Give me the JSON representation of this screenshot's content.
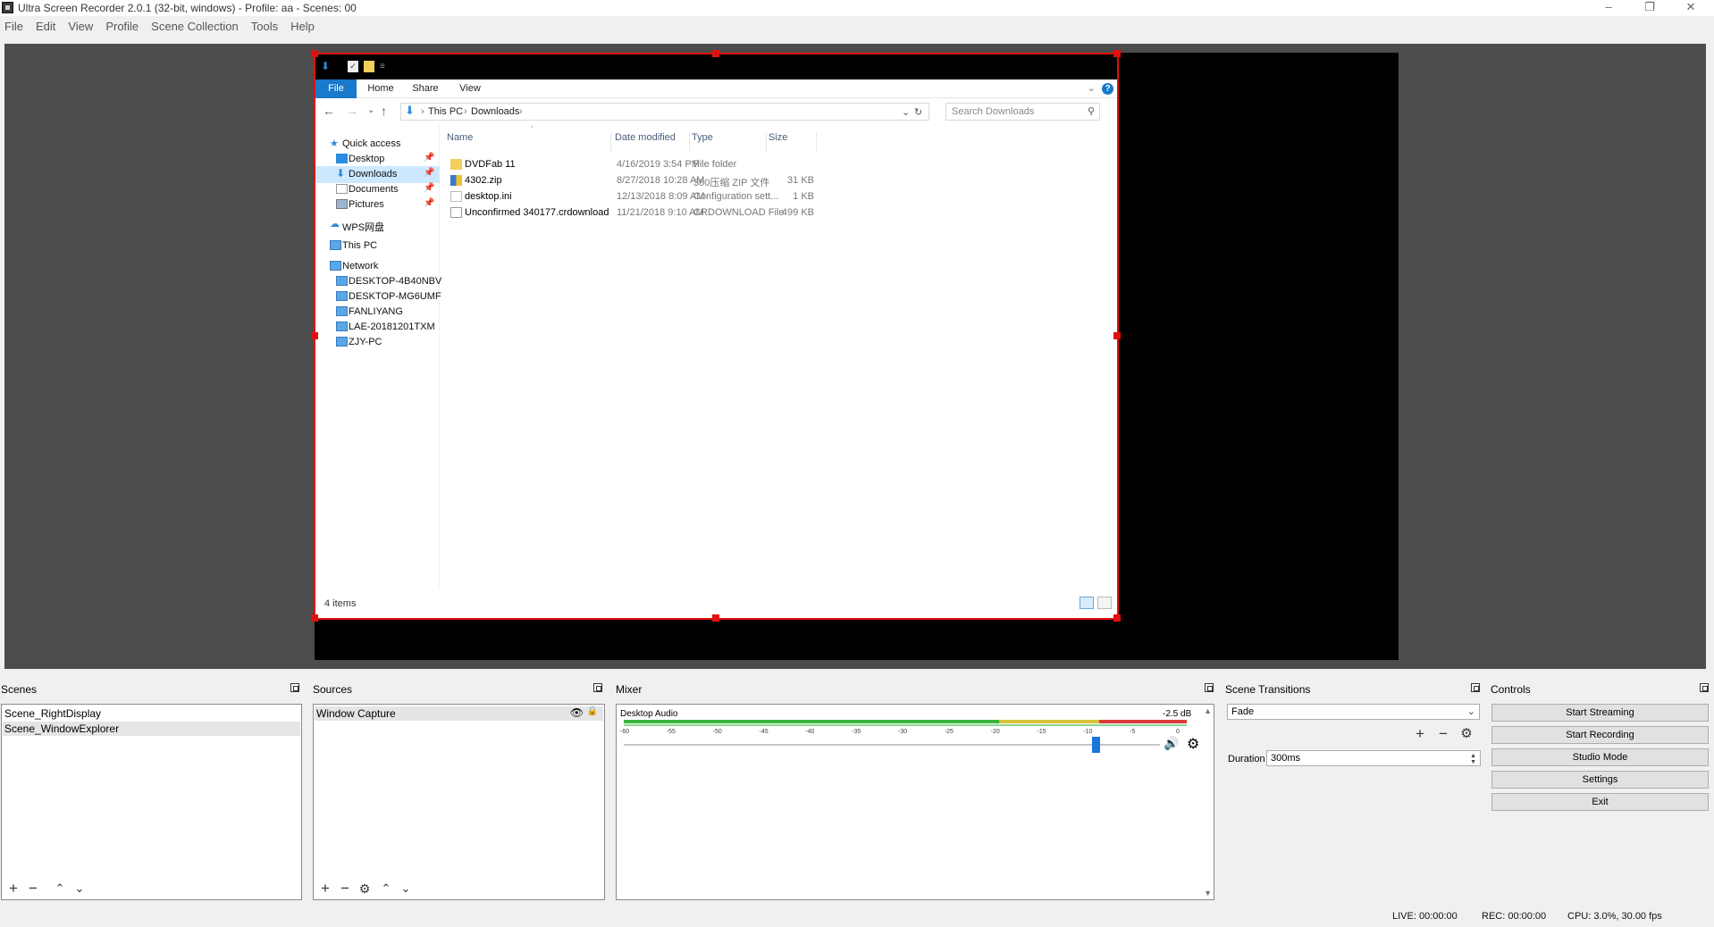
{
  "window": {
    "title": "Ultra Screen Recorder 2.0.1 (32-bit, windows) - Profile: aa - Scenes: 00",
    "minimize": "–",
    "maximize": "❐",
    "close": "✕"
  },
  "menu": [
    "File",
    "Edit",
    "View",
    "Profile",
    "Scene Collection",
    "Tools",
    "Help"
  ],
  "explorer": {
    "ribbon_tabs": [
      "File",
      "Home",
      "Share",
      "View"
    ],
    "help_glyph": "?",
    "breadcrumb": [
      "This PC",
      "Downloads"
    ],
    "search_placeholder": "Search Downloads",
    "nav": [
      {
        "label": "Quick access",
        "icon": "star-icon",
        "pinned": false
      },
      {
        "label": "Desktop",
        "icon": "desktop-folder-icon",
        "pinned": true
      },
      {
        "label": "Downloads",
        "icon": "download-folder-icon",
        "pinned": true,
        "selected": true
      },
      {
        "label": "Documents",
        "icon": "documents-folder-icon",
        "pinned": true
      },
      {
        "label": "Pictures",
        "icon": "pictures-folder-icon",
        "pinned": true
      },
      {
        "label": "WPS网盘",
        "icon": "cloud-icon",
        "pinned": false
      },
      {
        "label": "This PC",
        "icon": "computer-icon",
        "pinned": false
      },
      {
        "label": "Network",
        "icon": "network-icon",
        "pinned": false
      },
      {
        "label": "DESKTOP-4B40NBV",
        "icon": "computer-icon",
        "pinned": false
      },
      {
        "label": "DESKTOP-MG6UMF",
        "icon": "computer-icon",
        "pinned": false
      },
      {
        "label": "FANLIYANG",
        "icon": "computer-icon",
        "pinned": false
      },
      {
        "label": "LAE-20181201TXM",
        "icon": "computer-icon",
        "pinned": false
      },
      {
        "label": "ZJY-PC",
        "icon": "computer-icon",
        "pinned": false
      }
    ],
    "columns": [
      "Name",
      "Date modified",
      "Type",
      "Size"
    ],
    "files": [
      {
        "name": "DVDFab 11",
        "date": "4/16/2019 3:54 PM",
        "type": "File folder",
        "size": "",
        "icon": "folder-icon"
      },
      {
        "name": "4302.zip",
        "date": "8/27/2018 10:28 AM",
        "type": "360压缩 ZIP 文件",
        "size": "31 KB",
        "icon": "zip-icon"
      },
      {
        "name": "desktop.ini",
        "date": "12/13/2018 8:09 AM",
        "type": "Configuration sett...",
        "size": "1 KB",
        "icon": "settings-file-icon"
      },
      {
        "name": "Unconfirmed 340177.crdownload",
        "date": "11/21/2018 9:10 AM",
        "type": "CRDOWNLOAD File",
        "size": "499 KB",
        "icon": "file-icon"
      }
    ],
    "status": "4 items"
  },
  "scenes": {
    "title": "Scenes",
    "items": [
      "Scene_RightDisplay",
      "Scene_WindowExplorer"
    ]
  },
  "sources": {
    "title": "Sources",
    "items": [
      "Window Capture"
    ]
  },
  "mixer": {
    "title": "Mixer",
    "channel": "Desktop Audio",
    "db": "-2.5 dB",
    "ticks": [
      "-60",
      "-55",
      "-50",
      "-45",
      "-40",
      "-35",
      "-30",
      "-25",
      "-20",
      "-15",
      "-10",
      "-5",
      "0"
    ],
    "volume_fraction": 0.88
  },
  "transitions": {
    "title": "Scene Transitions",
    "selected": "Fade",
    "duration_label": "Duration",
    "duration_value": "300ms"
  },
  "controls": {
    "title": "Controls",
    "buttons": [
      "Start Streaming",
      "Start Recording",
      "Studio Mode",
      "Settings",
      "Exit"
    ]
  },
  "status": {
    "live": "LIVE: 00:00:00",
    "rec": "REC: 00:00:00",
    "cpu": "CPU: 3.0%, 30.00 fps"
  },
  "colors": {
    "selection_outline": "#e01010",
    "explorer_accent": "#1979ca",
    "meter_green": "#3cb43c",
    "meter_yellow": "#d8c23a",
    "meter_red": "#d83a3a",
    "slider_thumb": "#1c75d8"
  }
}
